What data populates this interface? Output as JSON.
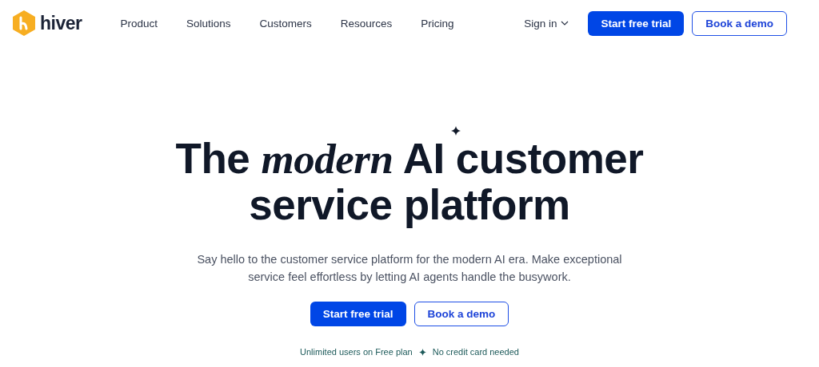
{
  "header": {
    "logo_text": "hiver",
    "nav": [
      {
        "label": "Product"
      },
      {
        "label": "Solutions"
      },
      {
        "label": "Customers"
      },
      {
        "label": "Resources"
      },
      {
        "label": "Pricing"
      }
    ],
    "sign_in": "Sign in",
    "primary_button": "Start free trial",
    "secondary_button": "Book a demo"
  },
  "hero": {
    "headline": "The *modern* AI customer service platform",
    "subtitle": "Say hello to the customer service platform for the modern AI era. Make exceptional service feel effortless by letting AI agents handle the busywork.",
    "primary_button": "Start free trial",
    "secondary_button": "Book a demo",
    "notes": [
      "Unlimited users on Free plan",
      "No credit card needed"
    ]
  }
}
